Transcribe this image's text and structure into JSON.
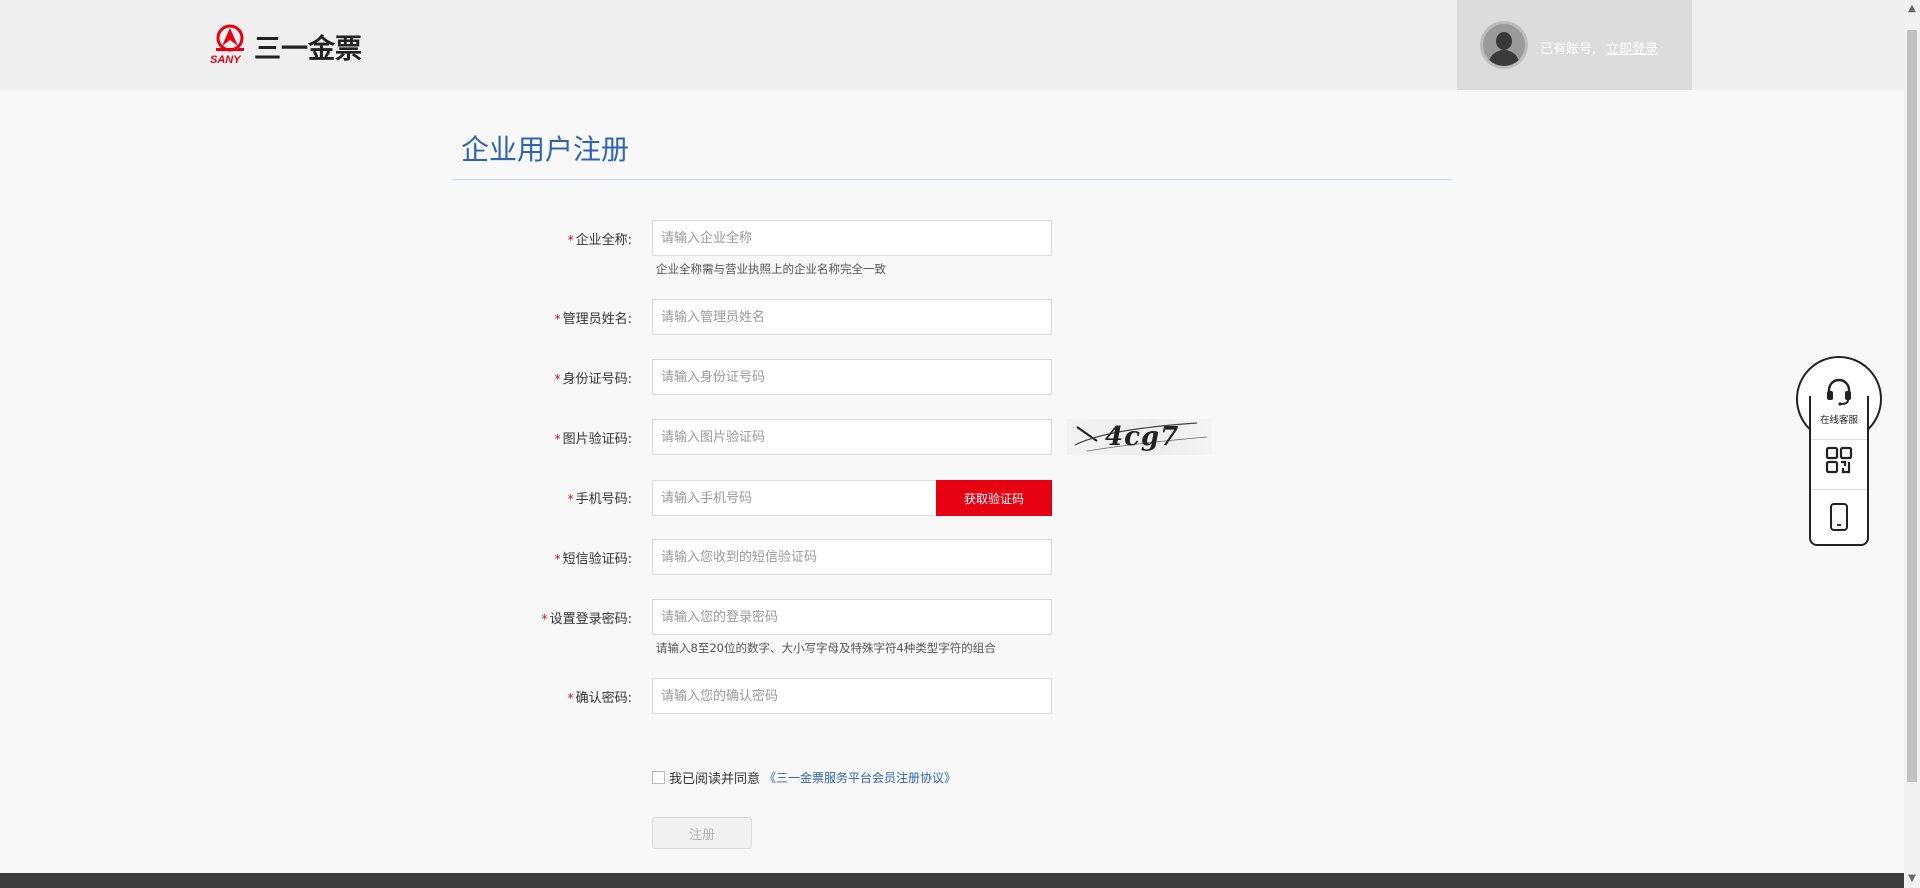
{
  "header": {
    "logo_word": "SANY",
    "logo_text": "三一金票",
    "has_account_text": "已有账号,",
    "login_link": "立即登录"
  },
  "page": {
    "title": "企业用户注册"
  },
  "form": {
    "required_mark": "*",
    "company_name": {
      "label": "企业全称:",
      "placeholder": "请输入企业全称",
      "hint": "企业全称需与营业执照上的企业名称完全一致"
    },
    "admin_name": {
      "label": "管理员姓名:",
      "placeholder": "请输入管理员姓名"
    },
    "id_number": {
      "label": "身份证号码:",
      "placeholder": "请输入身份证号码"
    },
    "image_captcha": {
      "label": "图片验证码:",
      "placeholder": "请输入图片验证码",
      "captcha_text": "4cg7"
    },
    "phone": {
      "label": "手机号码:",
      "placeholder": "请输入手机号码",
      "get_code_button": "获取验证码"
    },
    "sms_code": {
      "label": "短信验证码:",
      "placeholder": "请输入您收到的短信验证码"
    },
    "password": {
      "label": "设置登录密码:",
      "placeholder": "请输入您的登录密码",
      "hint": "请输入8至20位的数字、大小写字母及特殊字符4种类型字符的组合"
    },
    "confirm_password": {
      "label": "确认密码:",
      "placeholder": "请输入您的确认密码"
    },
    "agreement": {
      "text": "我已阅读并同意",
      "link": "《三一金票服务平台会员注册协议》",
      "checked": false
    },
    "submit_button": "注册"
  },
  "float_widget": {
    "service_label": "在线客服",
    "icons": [
      "headset-icon",
      "qrcode-icon",
      "mobile-phone-icon"
    ]
  },
  "colors": {
    "brand_red": "#e60012",
    "title_blue": "#2f64b5",
    "header_bg": "#efefef"
  }
}
